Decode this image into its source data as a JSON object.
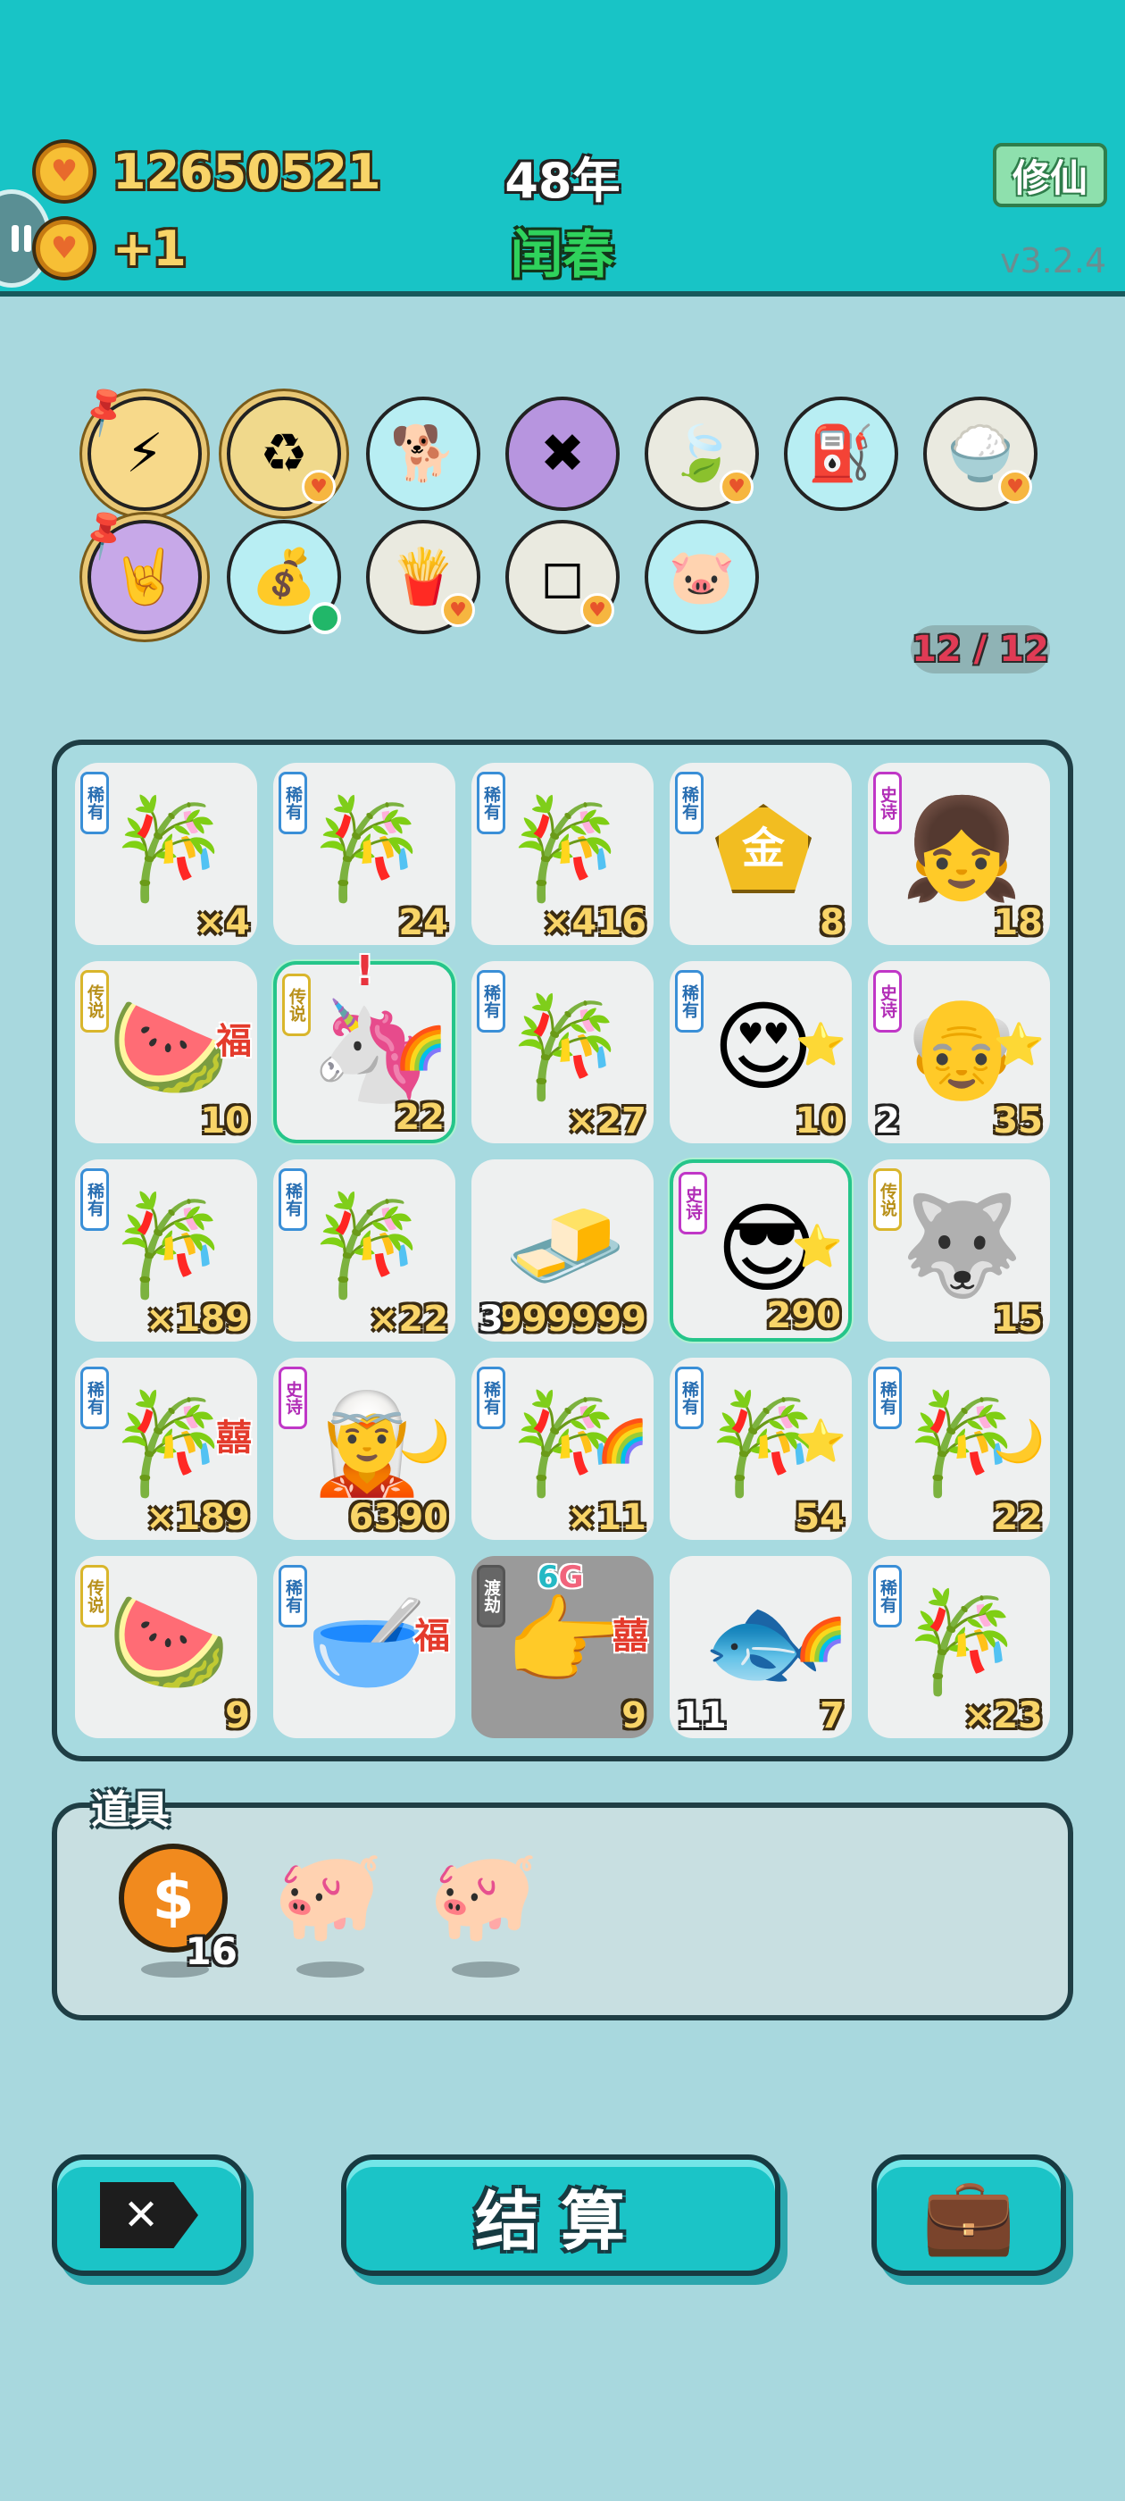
{
  "header": {
    "coins": "12650521",
    "income": "+1",
    "year": "48年",
    "season": "闰春",
    "mode_button": "修仙",
    "version": "v3.2.4"
  },
  "relics": [
    {
      "icon": "lightning-icon",
      "glyph": "⚡",
      "bg": "#f7d98a",
      "pinned": true
    },
    {
      "icon": "refresh-icon",
      "glyph": "♻",
      "bg": "#f0d98c",
      "heart": true
    },
    {
      "icon": "cool-dog-icon",
      "glyph": "🐕",
      "bg": "#b8eef3"
    },
    {
      "icon": "math-bird-icon",
      "glyph": "✖",
      "bg": "#b795df"
    },
    {
      "icon": "leaf-icon",
      "glyph": "🍃",
      "bg": "#eaeae0",
      "heart": true
    },
    {
      "icon": "pump-icon",
      "glyph": "⛽",
      "bg": "#b8eef3"
    },
    {
      "icon": "rice-bowl-icon",
      "glyph": "🍚",
      "bg": "#eaeae0",
      "heart": true
    },
    {
      "icon": "rock-hand-icon",
      "glyph": "🤘",
      "bg": "#c7a8e8",
      "pinned": true
    },
    {
      "icon": "money-sack-icon",
      "glyph": "💰",
      "bg": "#b8eef3",
      "dot": true
    },
    {
      "icon": "fries-icon",
      "glyph": "🍟",
      "bg": "#eaeae0",
      "heart": true
    },
    {
      "icon": "sugar-cubes-icon",
      "glyph": "◻",
      "bg": "#eaeae0",
      "heart": true
    },
    {
      "icon": "piggy-bank-icon",
      "glyph": "🐷",
      "bg": "#b8eef3"
    }
  ],
  "slots": "12 / 12",
  "tiles": [
    {
      "rarity": "稀有",
      "rc": "blue",
      "icon": "bamboo-icon",
      "glyph": "🎋",
      "count": "×4"
    },
    {
      "rarity": "稀有",
      "rc": "blue",
      "icon": "bamboo-icon",
      "glyph": "🎋",
      "count": "24"
    },
    {
      "rarity": "稀有",
      "rc": "blue",
      "icon": "bamboo-icon",
      "glyph": "🎋",
      "count": "×416"
    },
    {
      "rarity": "稀有",
      "rc": "blue",
      "icon": "gold-ingot-icon",
      "glyph": "金",
      "count": "8"
    },
    {
      "rarity": "史诗",
      "rc": "purple",
      "icon": "girl-braids-icon",
      "glyph": "👧",
      "count": "18"
    },
    {
      "rarity": "传说",
      "rc": "gold",
      "icon": "watermelon-icon",
      "glyph": "🍉",
      "count": "10",
      "mod": "福"
    },
    {
      "rarity": "传说",
      "rc": "gold",
      "icon": "unicorn-icon",
      "glyph": "🦄",
      "count": "22",
      "mod": "🌈",
      "hl": true
    },
    {
      "rarity": "稀有",
      "rc": "blue",
      "icon": "bamboo-icon",
      "glyph": "🎋",
      "count": "×27"
    },
    {
      "rarity": "稀有",
      "rc": "blue",
      "icon": "heart-eyes-man-icon",
      "glyph": "😍",
      "count": "10",
      "mod": "⭐"
    },
    {
      "rarity": "史诗",
      "rc": "purple",
      "icon": "grandpa-icon",
      "glyph": "👴",
      "count": "35",
      "mod": "⭐",
      "left": "2"
    },
    {
      "rarity": "稀有",
      "rc": "blue",
      "icon": "bamboo-icon",
      "glyph": "🎋",
      "count": "×189"
    },
    {
      "rarity": "稀有",
      "rc": "blue",
      "icon": "bamboo-icon",
      "glyph": "🎋",
      "count": "×22"
    },
    {
      "rarity": "",
      "rc": "blue",
      "icon": "silver-bars-icon",
      "glyph": "🧈",
      "count": "999999",
      "left": "3"
    },
    {
      "rarity": "史诗",
      "rc": "purple",
      "icon": "cool-grandpa-icon",
      "glyph": "😎",
      "count": "290",
      "mod": "⭐",
      "hl": true
    },
    {
      "rarity": "传说",
      "rc": "gold",
      "icon": "husky-king-icon",
      "glyph": "🐺",
      "count": "15"
    },
    {
      "rarity": "稀有",
      "rc": "blue",
      "icon": "bamboo-icon",
      "glyph": "🎋",
      "count": "×189",
      "mod": "囍"
    },
    {
      "rarity": "史诗",
      "rc": "purple",
      "icon": "fairy-girl-icon",
      "glyph": "🧝",
      "count": "6390",
      "mod": "🌙"
    },
    {
      "rarity": "稀有",
      "rc": "blue",
      "icon": "bamboo-icon",
      "glyph": "🎋",
      "count": "×11",
      "mod": "🌈"
    },
    {
      "rarity": "稀有",
      "rc": "blue",
      "icon": "bamboo-icon",
      "glyph": "🎋",
      "count": "54",
      "mod": "⭐"
    },
    {
      "rarity": "稀有",
      "rc": "blue",
      "icon": "bamboo-icon",
      "glyph": "🎋",
      "count": "22",
      "mod": "🌙"
    },
    {
      "rarity": "传说",
      "rc": "gold",
      "icon": "watermelon-icon",
      "glyph": "🍉",
      "count": "9"
    },
    {
      "rarity": "稀有",
      "rc": "blue",
      "icon": "smiling-bowl-icon",
      "glyph": "🥣",
      "count": "",
      "mod": "福"
    },
    {
      "rarity": "渡劫",
      "rc": "gray",
      "icon": "pointing-hand-icon",
      "glyph": "👉",
      "count": "9",
      "mod": "囍",
      "grey": true,
      "tag": "6G"
    },
    {
      "rarity": "",
      "rc": "blue",
      "icon": "fish-icon",
      "glyph": "🐟",
      "count": "7",
      "mod": "🌈",
      "left": "11"
    },
    {
      "rarity": "稀有",
      "rc": "blue",
      "icon": "bamboo-icon",
      "glyph": "🎋",
      "count": "×23"
    }
  ],
  "items_section": {
    "title": "道具",
    "items": [
      {
        "icon": "dollar-coin-icon",
        "count": "16"
      },
      {
        "icon": "piggy-bank-icon",
        "count": ""
      },
      {
        "icon": "piggy-bank-icon",
        "count": ""
      }
    ]
  },
  "buttons": {
    "close_icon": "close-icon",
    "settle_label": "结算",
    "bag_icon": "briefcase-icon"
  }
}
